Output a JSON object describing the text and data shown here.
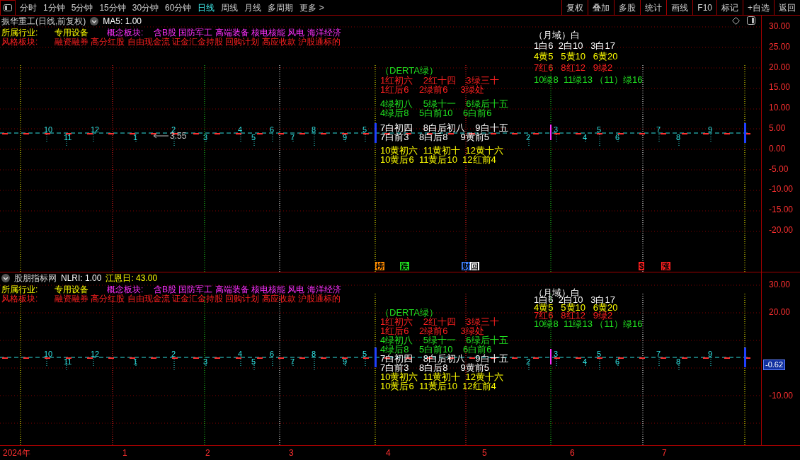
{
  "toolbar": {
    "periods": [
      {
        "label": "分时",
        "selected": false
      },
      {
        "label": "1分钟",
        "selected": false
      },
      {
        "label": "5分钟",
        "selected": false
      },
      {
        "label": "15分钟",
        "selected": false
      },
      {
        "label": "30分钟",
        "selected": false
      },
      {
        "label": "60分钟",
        "selected": false
      },
      {
        "label": "日线",
        "selected": true
      },
      {
        "label": "周线",
        "selected": false
      },
      {
        "label": "月线",
        "selected": false
      },
      {
        "label": "多周期",
        "selected": false
      },
      {
        "label": "更多 >",
        "selected": false
      }
    ],
    "actions": [
      "复权",
      "叠加",
      "多股",
      "统计",
      "画线",
      "F10",
      "标记",
      "+自选",
      "返回"
    ]
  },
  "top_chart": {
    "title": "振华重工(日线,前复权)",
    "indicators": [
      {
        "label": "MA5: 1.00",
        "color": "#ffffff"
      }
    ],
    "info": {
      "industry_label": "所属行业:",
      "industry": "专用设备",
      "concept_label": "概念板块:",
      "concepts": "含B股 国防军工 高端装备 核电核能 风电 海洋经济",
      "style_label": "风格板块:",
      "styles": "融资融券 高分红股 自由现金流 证金汇金持股 回购计划 高应收款 沪股通标的"
    },
    "wave_labels": [
      "10",
      "11",
      "12",
      "1",
      "2",
      "3",
      "4",
      "5",
      "6",
      "7",
      "8",
      "9",
      "5",
      "2",
      "3",
      "4",
      "5",
      "6",
      "7",
      "8",
      "9"
    ],
    "price_note": "3.55",
    "month_block": [
      {
        "text": "（月域）白",
        "color": "#ffffff"
      },
      {
        "text": "1白6  2白10   3白17",
        "color": "#ffffff"
      },
      {
        "text": "4黄5   5黄10   6黄20",
        "color": "#ffff00"
      },
      {
        "text": "7红6   8红12   9绿2",
        "color": "#ff2020"
      },
      {
        "text": "10绿8  11绿13 （11）绿16",
        "color": "#20e020"
      }
    ],
    "derta_block": [
      {
        "text": "（DERTA绿）",
        "color": "#20e020"
      },
      {
        "text": "1红初六    2红十四    3绿三十",
        "color": "#ff2020"
      },
      {
        "text": "1红后6    2绿前6     3绿处",
        "color": "#ff2020"
      },
      {
        "text": "4绿初八    5绿十一    6绿后十五",
        "color": "#20e020"
      },
      {
        "text": "4绿后8    5白前10    6白前6",
        "color": "#20e020"
      },
      {
        "text": "7白初四    8白后初八    9白十五",
        "color": "#ffffff"
      },
      {
        "text": "7白前3    8白后8     9黄前5",
        "color": "#ffffff"
      },
      {
        "text": "10黄初六  11黄初十  12黄十六",
        "color": "#ffff00"
      },
      {
        "text": "10黄后6  11黄后10  12红前4",
        "color": "#ffff00"
      }
    ],
    "markers": [
      {
        "text": "榜",
        "color": "#ff8c00"
      },
      {
        "text": "跌",
        "color": "#20e020"
      },
      {
        "text": "财",
        "color": "#4080ff"
      },
      {
        "text": "回",
        "color": "#ffffff"
      },
      {
        "text": "$",
        "color": "#ff2020"
      },
      {
        "text": "涨",
        "color": "#ff2020"
      }
    ],
    "axis": [
      {
        "label": "30.00",
        "kind": "tick"
      },
      {
        "label": "25.00",
        "kind": "tick"
      },
      {
        "label": "20.00",
        "kind": "tick"
      },
      {
        "label": "15.00",
        "kind": "tick"
      },
      {
        "label": "10.00",
        "kind": "tick"
      },
      {
        "label": "5.00",
        "kind": "tick"
      },
      {
        "label": "0.00",
        "kind": "tick"
      },
      {
        "label": "-5.00",
        "kind": "tick"
      },
      {
        "label": "-10.00",
        "kind": "tick"
      },
      {
        "label": "-15.00",
        "kind": "tick"
      },
      {
        "label": "-20.00",
        "kind": "tick"
      }
    ]
  },
  "bottom_chart": {
    "title": "股朋指标网",
    "indicators": [
      {
        "label": "NLRI: 1.00",
        "color": "#ffffff"
      },
      {
        "label": "江恩日: 43.00",
        "color": "#ffff00"
      }
    ],
    "info": {
      "industry_label": "所属行业:",
      "industry": "专用设备",
      "concept_label": "概念板块:",
      "concepts": "含B股 国防军工 高端装备 核电核能 风电 海洋经济",
      "style_label": "风格板块:",
      "styles": "融资融券 高分红股 自由现金流 证金汇金持股 回购计划 高应收款 沪股通标的"
    },
    "wave_labels": [
      "10",
      "11",
      "12",
      "1",
      "2",
      "3",
      "4",
      "5",
      "6",
      "7",
      "8",
      "9",
      "5",
      "2",
      "3",
      "4",
      "5",
      "6",
      "7",
      "8",
      "9"
    ],
    "month_block": [
      {
        "text": "（月域）白",
        "color": "#ffffff"
      },
      {
        "text": "1白6  2白10   3白17",
        "color": "#ffffff"
      },
      {
        "text": "4黄5   5黄10   6黄20",
        "color": "#ffff00"
      },
      {
        "text": "7红6   8红12   9绿2",
        "color": "#ff2020"
      },
      {
        "text": "10绿8  11绿13 （11）绿16",
        "color": "#20e020"
      }
    ],
    "derta_block": [
      {
        "text": "（DERTA绿）",
        "color": "#20e020"
      },
      {
        "text": "1红初六    2红十四    3绿三十",
        "color": "#ff2020"
      },
      {
        "text": "1红后6    2绿前6     3绿处",
        "color": "#ff2020"
      },
      {
        "text": "4绿初八    5绿十一    6绿后十五",
        "color": "#20e020"
      },
      {
        "text": "4绿后8    5白前10    6白前6",
        "color": "#20e020"
      },
      {
        "text": "7白初四    8白后初八    9白十五",
        "color": "#ffffff"
      },
      {
        "text": "7白前3    8白后8     9黄前5",
        "color": "#ffffff"
      },
      {
        "text": "10黄初六  11黄初十  12黄十六",
        "color": "#ffff00"
      },
      {
        "text": "10黄后6  11黄后10  12红前4",
        "color": "#ffff00"
      }
    ],
    "axis": [
      {
        "label": "30.00",
        "kind": "tick"
      },
      {
        "label": "20.00",
        "kind": "tick"
      },
      {
        "label": "-0.62",
        "kind": "current"
      },
      {
        "label": "-10.00",
        "kind": "tick"
      }
    ]
  },
  "date_axis": [
    "2024年",
    "1",
    "2",
    "3",
    "4",
    "5",
    "6",
    "7"
  ]
}
